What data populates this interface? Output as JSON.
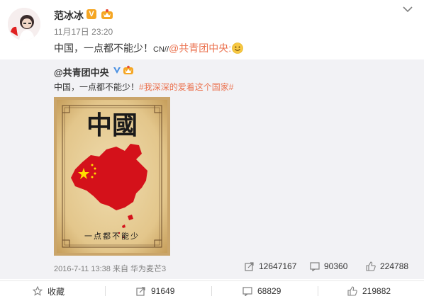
{
  "author": {
    "name": "范冰冰",
    "time": "11月17日 23:20"
  },
  "post": {
    "text": "中国，一点都不能少！",
    "cn_tag": "CN//",
    "mention": "@共青团中央:"
  },
  "repost": {
    "author": "@共青团中央",
    "text": "中国，一点都不能少！",
    "topic": "#我深深的爱着这个国家#",
    "poster": {
      "title": "中國",
      "slogan": "一点都不能少"
    },
    "meta": "2016-7-11 13:38 来自 华为麦芒3",
    "reposts": "12647167",
    "comments": "90360",
    "likes": "224788"
  },
  "actions": {
    "favorite": "收藏",
    "repost": "91649",
    "comment": "68829",
    "like": "219882"
  },
  "colors": {
    "accent": "#eb7350",
    "verified_orange": "#f5a623",
    "verified_blue": "#4a90e2",
    "china_red": "#d4111a"
  }
}
